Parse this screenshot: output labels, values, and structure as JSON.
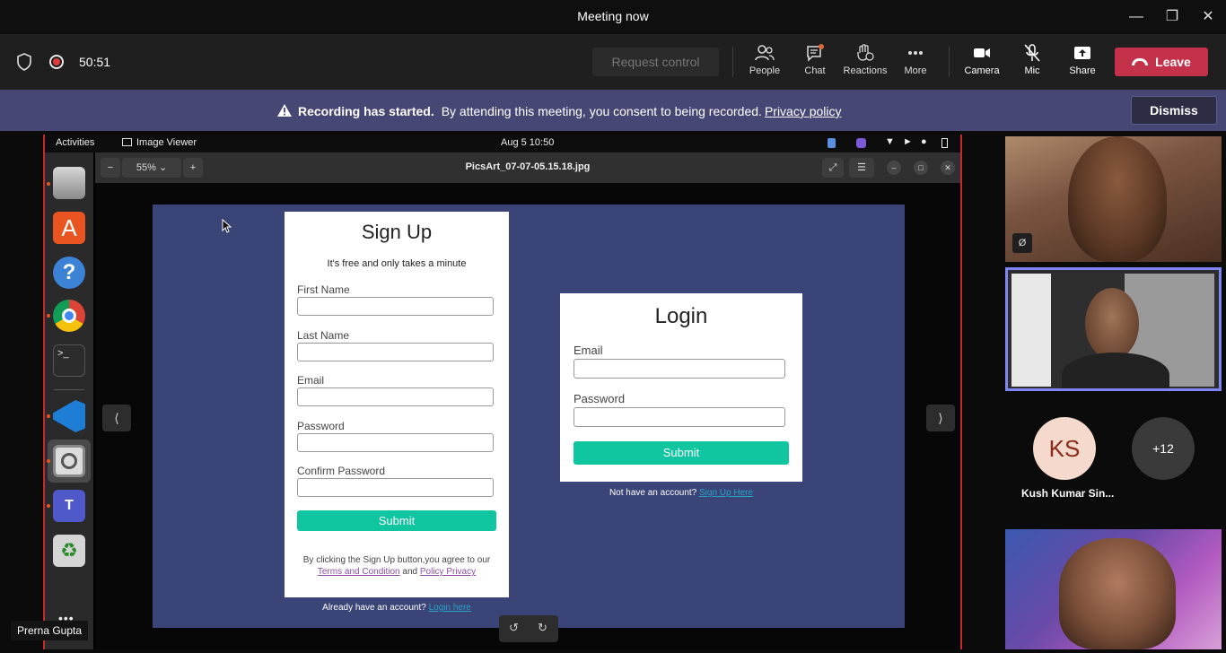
{
  "window": {
    "title": "Meeting now"
  },
  "toolbar": {
    "timer": "50:51",
    "request_control": "Request control",
    "people": "People",
    "chat": "Chat",
    "reactions": "Reactions",
    "more": "More",
    "camera": "Camera",
    "mic": "Mic",
    "share": "Share",
    "leave": "Leave"
  },
  "banner": {
    "bold": "Recording has started.",
    "text": "By attending this meeting, you consent to being recorded.",
    "link": "Privacy policy",
    "dismiss": "Dismiss"
  },
  "shared_screen": {
    "top_bar": {
      "activities": "Activities",
      "app": "Image Viewer",
      "clock": "Aug 5  10:50"
    },
    "viewer": {
      "zoom": "55%",
      "file": "PicsArt_07-07-05.15.18.jpg"
    },
    "signup": {
      "title": "Sign Up",
      "subtitle": "It's free and only takes a minute",
      "fields": [
        "First Name",
        "Last Name",
        "Email",
        "Password",
        "Confirm Password"
      ],
      "submit": "Submit",
      "terms_prefix": "By clicking the Sign Up button,you agree to our",
      "terms_link": "Terms and Condition",
      "and": "and",
      "privacy_link": "Policy Privacy",
      "already": "Already have an account?",
      "login_link": "Login here"
    },
    "login": {
      "title": "Login",
      "fields": [
        "Email",
        "Password"
      ],
      "submit": "Submit",
      "no_account": "Not have an account?",
      "signup_link": "Sign Up Here"
    },
    "presenter": "Prerna Gupta"
  },
  "participants": {
    "ks_initials": "KS",
    "ks_name": "Kush Kumar Sin...",
    "overflow": "+12"
  },
  "colors": {
    "leave": "#c4314b",
    "banner": "#464775",
    "accent": "#0fc6a0"
  }
}
